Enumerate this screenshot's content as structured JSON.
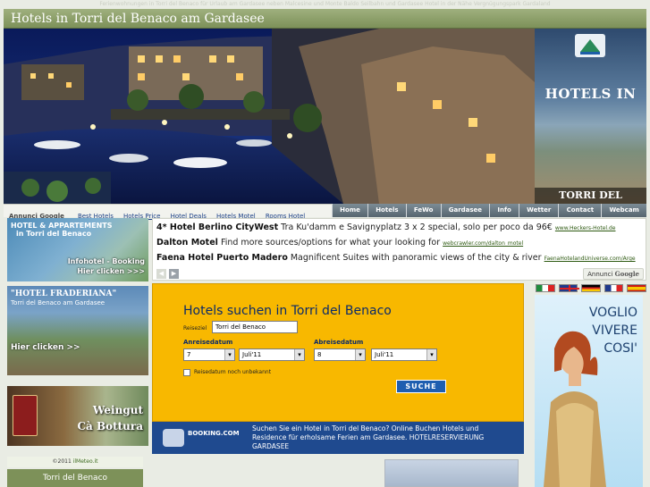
{
  "tagline": "Ferienwohnungen in Torri del Benaco für Urlaub am Gardasee neben Malcesine und Monte Baldo Seilbahn und Gardasee Hotel in der Nähe Vergnügungspark Gardaland",
  "header": {
    "title": "Hotels in Torri del Benaco am Gardasee"
  },
  "side_banner": {
    "line1": "HOTELS IN",
    "line2": "TORRI DEL BENACO"
  },
  "linkbar": {
    "adsense": "Annunci Google",
    "links": [
      "Best Hotels",
      "Hotels Price",
      "Hotel Deals",
      "Hotels Motel",
      "Rooms Hotel"
    ]
  },
  "nav": [
    "Home",
    "Hotels",
    "FeWo",
    "Gardasee",
    "Info",
    "Wetter",
    "Contact",
    "Webcam"
  ],
  "left_ads": {
    "box1": {
      "line1": "HOTEL & APPARTEMENTS",
      "line2": "in Torri del Benaco",
      "line3": "Infohotel - Booking",
      "line4": "Hier clicken >>>"
    },
    "box2": {
      "line1": "\"HOTEL FRADERIANA\"",
      "line2": "Torri del Benaco am Gardasee",
      "line3": "Hier clicken >>"
    },
    "box3": {
      "line1": "Weingut",
      "line2": "Cà Bottura"
    },
    "meteo_prefix": "©2011",
    "meteo_link": "ilMeteo.it",
    "meteo_place": "Torri del Benaco"
  },
  "ads": [
    {
      "headline": "4* Hotel Berlino CityWest",
      "text": " Tra Ku'damm e Savignyplatz 3 x 2 special, solo per poco da 96€ ",
      "url": "www.Heckers-Hotel.de"
    },
    {
      "headline": "Dalton Motel",
      "text": " Find more sources/options for what your looking for ",
      "url": "webcrawler.com/dalton_motel"
    },
    {
      "headline": "Faena Hotel Puerto Madero",
      "text": " Magnificent Suites with panoramic views of the city & river ",
      "url": "FaenaHotelandUniverse.com/Arge"
    }
  ],
  "ads_badge": {
    "prefix": "Annunci",
    "brand": "Google"
  },
  "search": {
    "title": "Hotels suchen in Torri del Benaco",
    "destination_label": "Reiseziel",
    "destination_value": "Torri del Benaco",
    "arrival_label": "Anreisedatum",
    "departure_label": "Abreisedatum",
    "arrival_day": "7",
    "arrival_month": "Juli'11",
    "departure_day": "8",
    "departure_month": "Juli'11",
    "unknown_dates_label": "Reisedatum noch unbekannt",
    "button": "SUCHE"
  },
  "booking": {
    "logo": "BOOKING.COM",
    "text": "Suchen Sie ein Hotel in Torri del Benaco? Online Buchen Hotels und Residence für erholsame Ferien am Gardasee. HOTELRESERVIERUNG GARDASEE"
  },
  "right_ad": {
    "line1": "VOGLIO",
    "line2": "VIVERE",
    "line3": "COSI'"
  },
  "colors": {
    "header_green": "#7d9159",
    "nav_gray": "#56656f",
    "search_yellow": "#f8b800",
    "booking_blue": "#1f4a8f"
  }
}
